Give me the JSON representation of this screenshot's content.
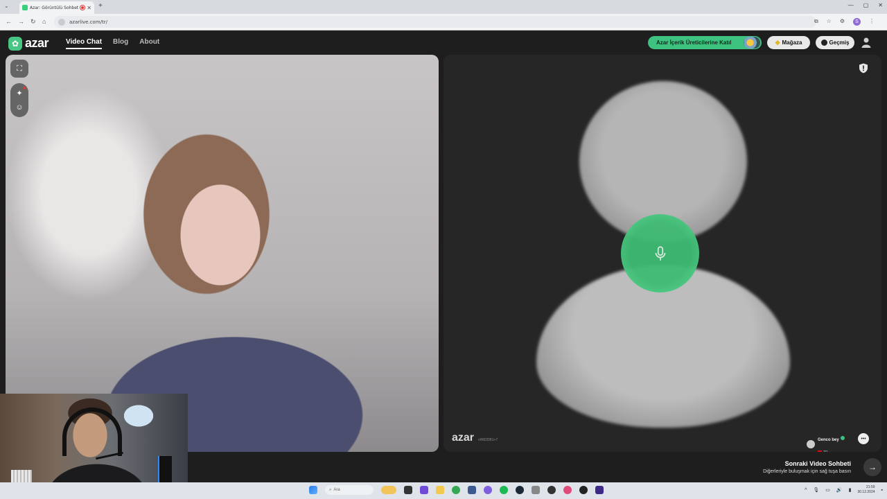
{
  "browser": {
    "tab_title": "Azar: Görüntülü Sohbet &",
    "tab_close": "✕",
    "new_tab": "+",
    "url": "azarlive.com/tr/"
  },
  "header": {
    "logo_text": "azar",
    "nav": [
      "Video Chat",
      "Blog",
      "About"
    ],
    "creator_button": "Azar İçerik Üreticilerine Katıl",
    "shop_button": "Mağaza",
    "history_button": "Geçmiş"
  },
  "remote": {
    "watermark": "azar",
    "code": "vW82DB1+7",
    "peer_name": "Genco bey",
    "peer_country": "TR"
  },
  "next": {
    "title": "Sonraki Video Sohbeti",
    "subtitle": "Diğerleriyle buluşmak için sağ tuşa basın"
  },
  "taskbar": {
    "search_placeholder": "Ara",
    "time": "21:59",
    "date": "30.12.2024"
  },
  "colors": {
    "accent_green": "#3dc27f",
    "background": "#1e1e1e"
  }
}
